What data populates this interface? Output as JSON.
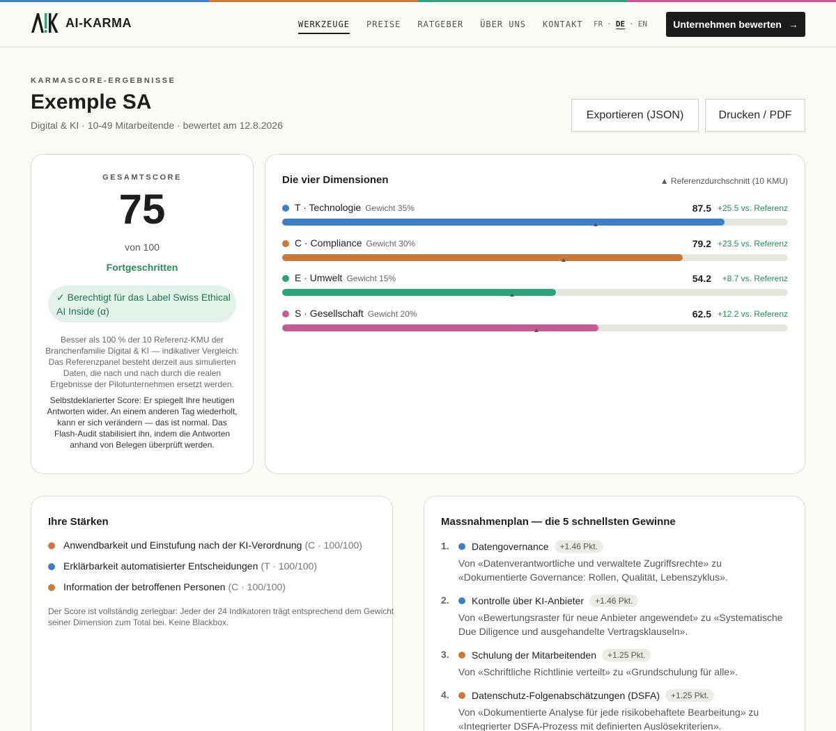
{
  "brand": {
    "name": "AI-KARMA",
    "logo_letters": "AIK",
    "stripe_colors": [
      "#3f7ecb",
      "#c97a3a",
      "#2ea27a",
      "#c35c94"
    ]
  },
  "nav": {
    "items": [
      {
        "label": "WERKZEUGE",
        "active": true
      },
      {
        "label": "PREISE"
      },
      {
        "label": "RATGEBER"
      },
      {
        "label": "ÜBER UNS"
      },
      {
        "label": "KONTAKT"
      }
    ],
    "languages": [
      "FR",
      "DE",
      "EN"
    ],
    "active_language": "DE",
    "lang_sep": "·",
    "cta_label": "Unternehmen bewerten",
    "cta_icon": "arrow-right-icon"
  },
  "page": {
    "eyebrow": "KARMASCORE-ERGEBNISSE",
    "title": "Exemple SA",
    "subtitle": "Digital & KI · 10-49 Mitarbeitende · bewertet am 12.8.2026",
    "export_label": "Exportieren (JSON)",
    "print_label": "Drucken / PDF"
  },
  "score": {
    "label": "GESAMTSCORE",
    "value": "75",
    "out_of": "von 100",
    "level": "Fortgeschritten",
    "badge": "✓ Berechtigt für das Label Swiss Ethical AI Inside (α)",
    "note": "Besser als 100 % der 10 Referenz-KMU der Branchenfamilie Digital & KI — indikativer Vergleich: Das Referenzpanel besteht derzeit aus simulierten Daten, die nach und nach durch die realen Ergebnisse der Pilotunternehmen ersetzt werden.",
    "disclaimer": "Selbstdeklarierter Score: Er spiegelt Ihre heutigen Antworten wider. An einem anderen Tag wiederholt, kann er sich verändern — das ist normal. Das Flash-Audit stabilisiert ihn, indem die Antworten anhand von Belegen überprüft werden."
  },
  "dimensions": {
    "title": "Die vier Dimensionen",
    "reference_legend": "▲ Referenzdurchschnitt (10 KMU)",
    "items": [
      {
        "name": "T · Technologie",
        "weight": "Gewicht 35%",
        "value_text": "87.5",
        "value": 87.5,
        "reference": 62,
        "delta": "+25.5 vs. Referenz",
        "color": "#3f7ecb"
      },
      {
        "name": "C · Compliance",
        "weight": "Gewicht 30%",
        "value_text": "79.2",
        "value": 79.2,
        "reference": 55.7,
        "delta": "+23.5 vs. Referenz",
        "color": "#c97a3a"
      },
      {
        "name": "E · Umwelt",
        "weight": "Gewicht 15%",
        "value_text": "54.2",
        "value": 54.2,
        "reference": 45.5,
        "delta": "+8.7 vs. Referenz",
        "color": "#2ea27a"
      },
      {
        "name": "S · Gesellschaft",
        "weight": "Gewicht 20%",
        "value_text": "62.5",
        "value": 62.5,
        "reference": 50.3,
        "delta": "+12.2 vs. Referenz",
        "color": "#c35c94"
      }
    ]
  },
  "strengths": {
    "title": "Ihre Stärken",
    "items": [
      {
        "label": "Anwendbarkeit und Einstufung nach der KI-Verordnung",
        "meta": "(C · 100/100)",
        "color": "#c97a3a"
      },
      {
        "label": "Erklärbarkeit automatisierter Entscheidungen",
        "meta": "(T · 100/100)",
        "color": "#3f7ecb"
      },
      {
        "label": "Information der betroffenen Personen",
        "meta": "(C · 100/100)",
        "color": "#c97a3a"
      }
    ],
    "footnote": "Der Score ist vollständig zerlegbar: Jeder der 24 Indikatoren trägt entsprechend dem Gewicht seiner Dimension zum Total bei. Keine Blackbox."
  },
  "plan": {
    "title": "Massnahmenplan — die 5 schnellsten Gewinne",
    "items": [
      {
        "num": "1.",
        "label": "Datengovernance",
        "points": "+1.46 Pkt.",
        "desc": "Von «Datenverantwortliche und verwaltete Zugriffsrechte» zu «Dokumentierte Governance: Rollen, Qualität, Lebenszyklus».",
        "color": "#3f7ecb"
      },
      {
        "num": "2.",
        "label": "Kontrolle über KI-Anbieter",
        "points": "+1.46 Pkt.",
        "desc": "Von «Bewertungsraster für neue Anbieter angewendet» zu «Systematische Due Diligence und ausgehandelte Vertragsklauseln».",
        "color": "#3f7ecb"
      },
      {
        "num": "3.",
        "label": "Schulung der Mitarbeitenden",
        "points": "+1.25 Pkt.",
        "desc": "Von «Schriftliche Richtlinie verteilt» zu «Grundschulung für alle».",
        "color": "#c97a3a"
      },
      {
        "num": "4.",
        "label": "Datenschutz-Folgenabschätzungen (DSFA)",
        "points": "+1.25 Pkt.",
        "desc": "Von «Dokumentierte Analyse für jede risikobehaftete Bearbeitung» zu «Integrierter DSFA-Prozess mit definierten Auslösekriterien».",
        "color": "#c97a3a"
      }
    ]
  }
}
